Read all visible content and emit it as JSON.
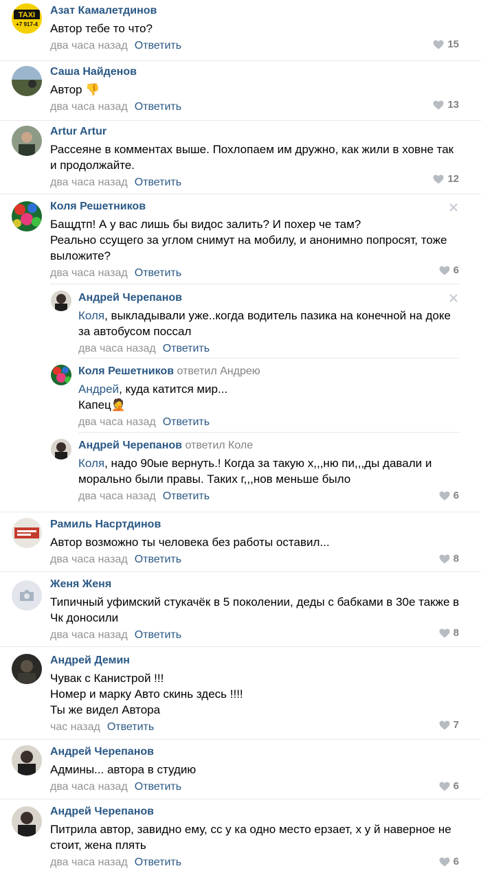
{
  "colors": {
    "author": "#2a5885",
    "meta": "#939393",
    "divider": "#e7e8ec",
    "likes": "#828282"
  },
  "comments": [
    {
      "author": "Азат Камалетдинов",
      "text": "Автор тебе то что?",
      "time": "два часа назад",
      "reply": "Ответить",
      "likes": "15",
      "avatar_text_1": "TAXI",
      "avatar_text_2": "+7 917-4"
    },
    {
      "author": "Саша Найденов",
      "text": "Автор",
      "emoji": "👎",
      "time": "два часа назад",
      "reply": "Ответить",
      "likes": "13"
    },
    {
      "author": "Artur Artur",
      "text": "Рассеяне в комментах выше. Похлопаем им дружно, как жили в ховне так и продолжайте.",
      "time": "два часа назад",
      "reply": "Ответить",
      "likes": "12"
    },
    {
      "author": "Коля Решетников",
      "text_1": "Бащдтп! А у вас лишь бы видос залить? И похер че там?",
      "text_2": "Реально ссущего за углом снимут на мобилу, и анонимно попросят, тоже выложите?",
      "time": "два часа назад",
      "reply": "Ответить",
      "likes": "6",
      "replies": [
        {
          "author": "Андрей Черепанов",
          "mention": "Коля",
          "text": ", выкладывали уже..когда водитель пазика на конечной на доке за автобусом поссал",
          "time": "два часа назад",
          "reply": "Ответить"
        },
        {
          "author": "Коля Решетников",
          "replied_to": "ответил Андрею",
          "mention": "Андрей",
          "text_1": ", куда катится мир...",
          "text_2": "Капец",
          "emoji": "🤦",
          "time": "два часа назад",
          "reply": "Ответить"
        },
        {
          "author": "Андрей Черепанов",
          "replied_to": "ответил Коле",
          "mention": "Коля",
          "text": ", надо 90ые вернуть.! Когда за такую х,,,ню пи,,,ды давали и морально были правы. Таких г,,,нов меньше было",
          "time": "два часа назад",
          "reply": "Ответить",
          "likes": "6"
        }
      ]
    },
    {
      "author": "Рамиль Насртдинов",
      "text": "Автор возможно ты человека без работы оставил...",
      "time": "два часа назад",
      "reply": "Ответить",
      "likes": "8"
    },
    {
      "author": "Женя Женя",
      "text": "Типичный уфимский стукачёк в 5 поколении, деды с бабками в 30е также в Чк доносили",
      "time": "два часа назад",
      "reply": "Ответить",
      "likes": "8"
    },
    {
      "author": "Андрей Демин",
      "text_1": "Чувак с Канистрой !!!",
      "text_2": "Номер и марку Авто скинь здесь !!!!",
      "text_3": "Ты же видел Автора",
      "time": "час назад",
      "reply": "Ответить",
      "likes": "7"
    },
    {
      "author": "Андрей Черепанов",
      "text": "Админы... автора в студию",
      "time": "два часа назад",
      "reply": "Ответить",
      "likes": "6"
    },
    {
      "author": "Андрей Черепанов",
      "text": "Питрила автор, завидно ему, сс у ка одно место ерзает, х у й наверное не стоит, жена плять",
      "time": "два часа назад",
      "reply": "Ответить",
      "likes": "6"
    }
  ]
}
